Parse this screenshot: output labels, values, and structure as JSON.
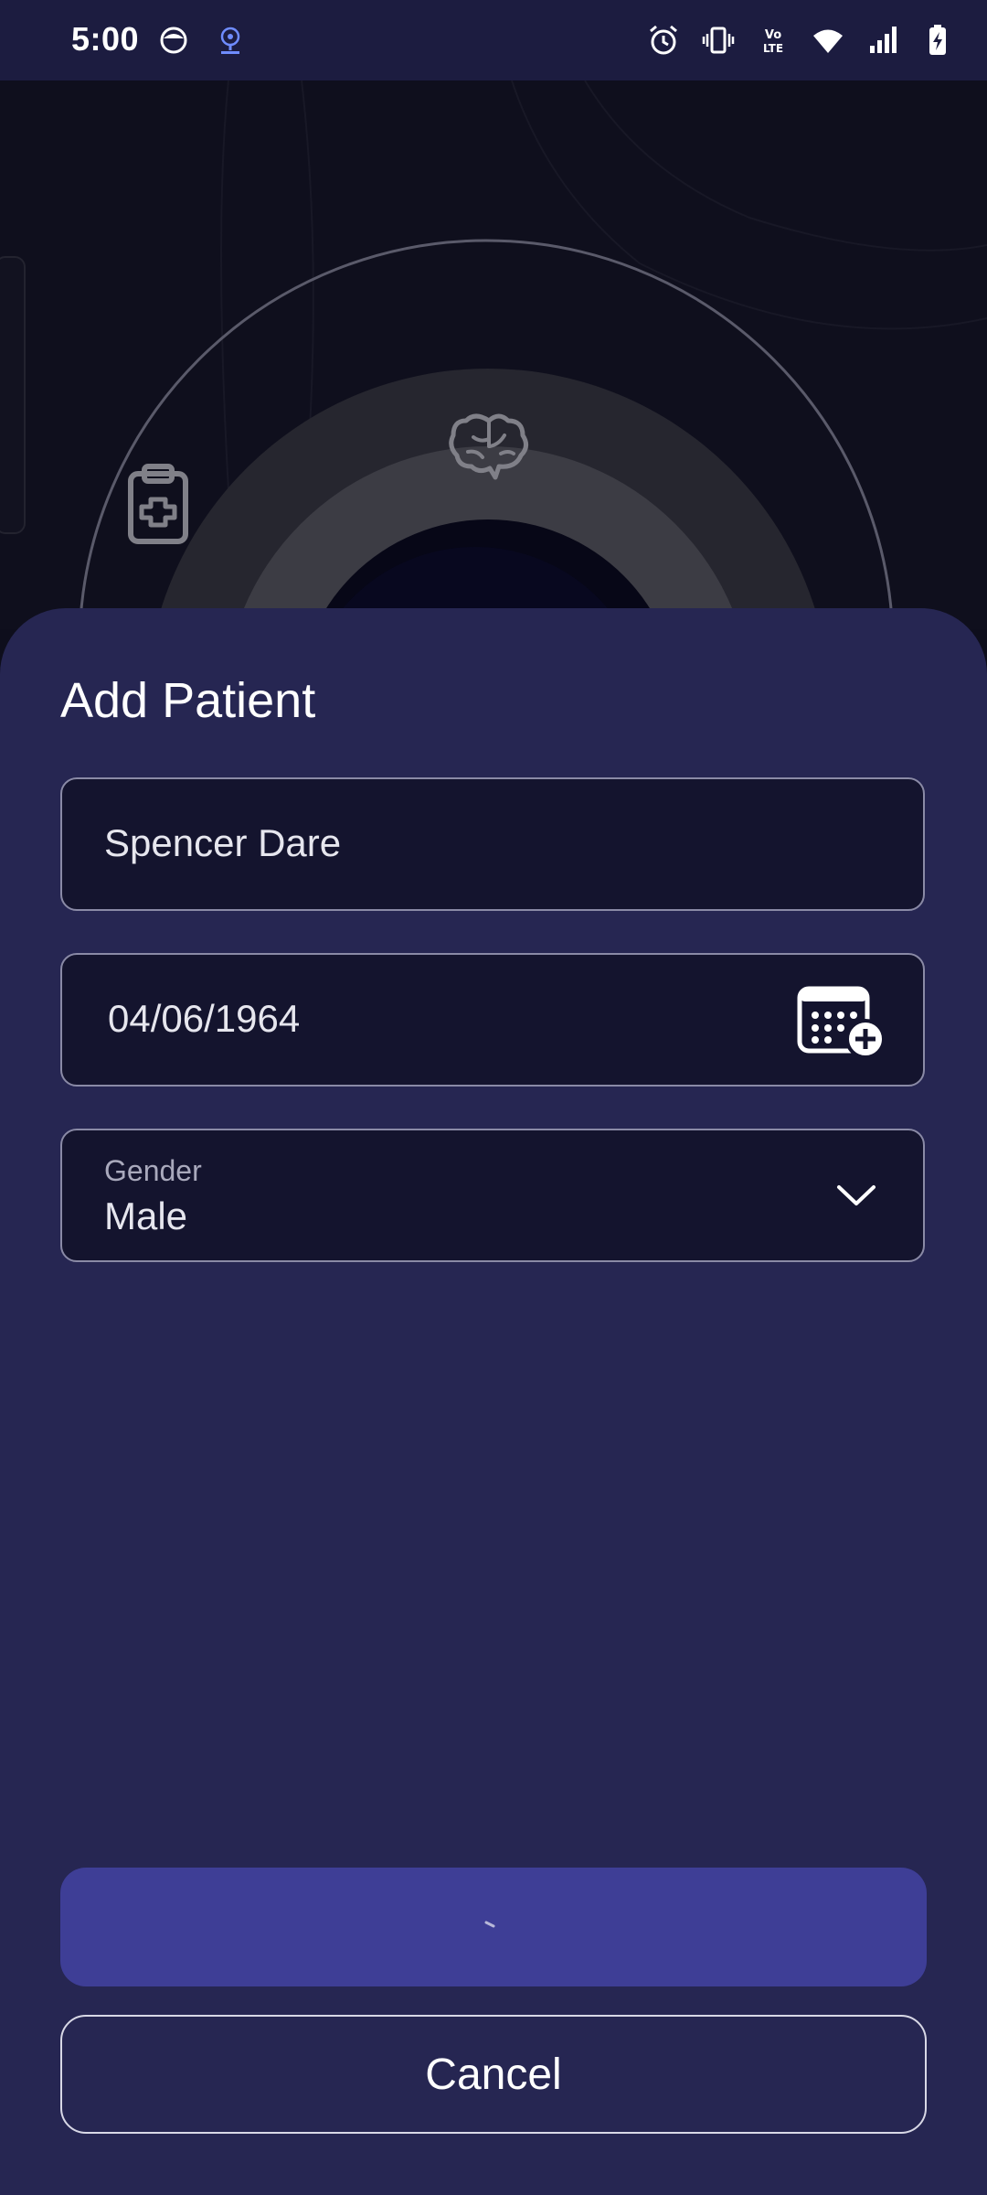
{
  "status_bar": {
    "time": "5:00",
    "left_icons": [
      "face-notification-icon",
      "podcast-notification-icon"
    ],
    "right_icons": [
      "alarm-icon",
      "vibrate-icon",
      "volte-icon",
      "wifi-icon",
      "signal-icon",
      "battery-charging-icon"
    ]
  },
  "background": {
    "icons": [
      "clipboard-medical-icon",
      "brain-icon"
    ]
  },
  "sheet": {
    "title": "Add Patient",
    "name_field": {
      "value": "Spencer Dare"
    },
    "dob_field": {
      "value": "04/06/1964",
      "icon": "calendar-add-icon"
    },
    "gender_field": {
      "label": "Gender",
      "value": "Male",
      "icon": "chevron-down-icon"
    },
    "submit_button": {
      "state": "loading"
    },
    "cancel_button": {
      "label": "Cancel"
    }
  },
  "colors": {
    "status_bar": "#1c1c40",
    "sheet_bg": "#262652",
    "field_bg": "#14142e",
    "primary_button": "#3e3e96"
  }
}
